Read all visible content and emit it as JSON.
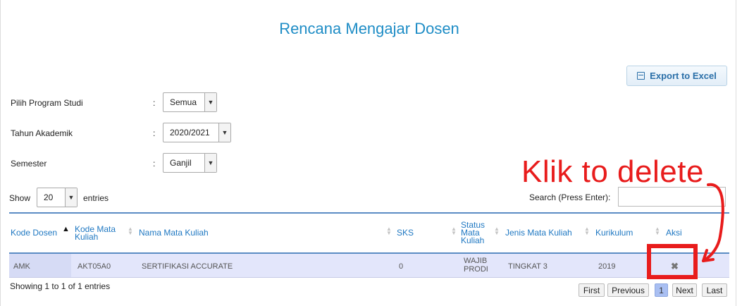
{
  "page": {
    "title": "Rencana Mengajar Dosen"
  },
  "toolbar": {
    "export_label": "Export to Excel"
  },
  "filters": {
    "program_studi": {
      "label": "Pilih Program Studi",
      "colon": ":",
      "value": "Semua"
    },
    "tahun_akademik": {
      "label": "Tahun Akademik",
      "colon": ":",
      "value": "2020/2021"
    },
    "semester": {
      "label": "Semester",
      "colon": ":",
      "value": "Ganjil"
    }
  },
  "table_controls": {
    "show_label": "Show",
    "page_size": "20",
    "entries_label": "entries",
    "search_label": "Search (Press Enter):",
    "search_value": ""
  },
  "table": {
    "columns": [
      "Kode Dosen",
      "Kode Mata Kuliah",
      "Nama Mata Kuliah",
      "SKS",
      "Status Mata Kuliah",
      "Jenis Mata Kuliah",
      "Kurikulum",
      "Aksi"
    ],
    "column_lines": {
      "kode_mk": [
        "Kode Mata",
        "Kuliah"
      ],
      "status": [
        "Status",
        "Mata",
        "Kuliah"
      ]
    },
    "rows": [
      {
        "kode_dosen": "AMK",
        "kode_mk": "AKT05A0",
        "nama_mk": "SERTIFIKASI ACCURATE",
        "sks": "0",
        "status": [
          "WAJIB",
          "PRODI"
        ],
        "jenis": "TINGKAT 3",
        "kurikulum": "2019",
        "aksi_icon": "delete-icon"
      }
    ]
  },
  "pagination": {
    "info": "Showing 1 to 1 of 1 entries",
    "first": "First",
    "previous": "Previous",
    "current": "1",
    "next": "Next",
    "last": "Last"
  },
  "annotation": {
    "text": "Klik to delete",
    "color": "#e81c1c"
  },
  "colors": {
    "accent": "#1f8dc6",
    "header_text": "#1f78c2",
    "row_bg": "#e3e6fb"
  }
}
